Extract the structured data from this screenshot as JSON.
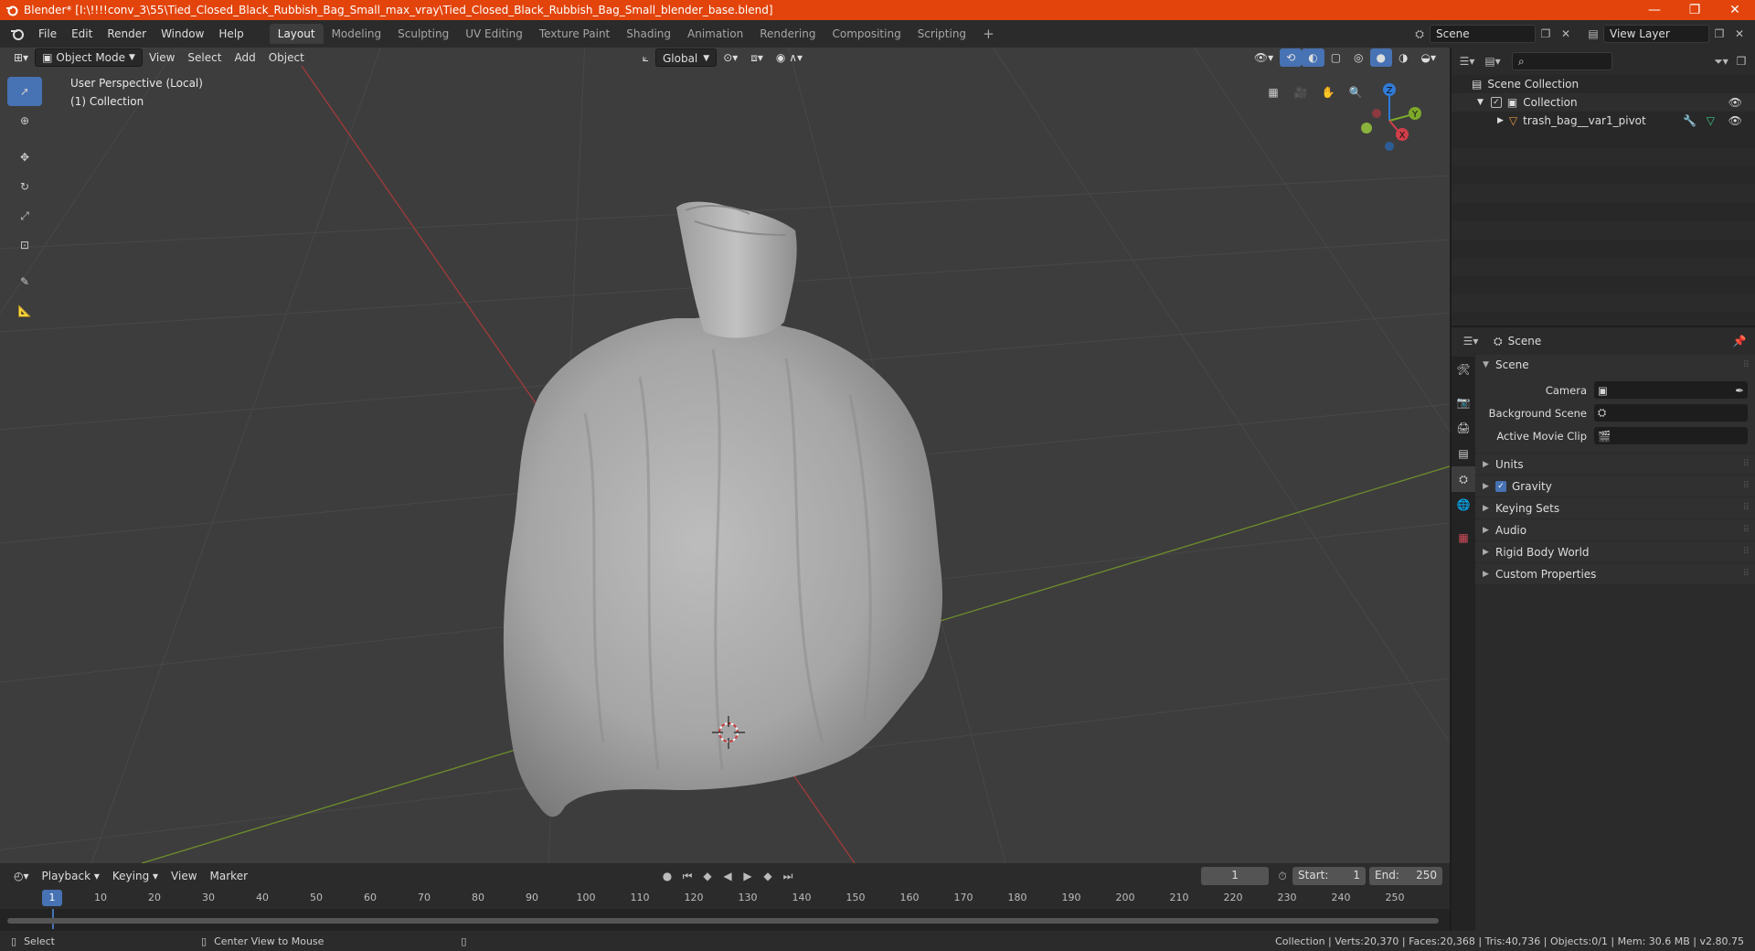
{
  "titlebar": {
    "title": "Blender* [I:\\!!!!conv_3\\55\\Tied_Closed_Black_Rubbish_Bag_Small_max_vray\\Tied_Closed_Black_Rubbish_Bag_Small_blender_base.blend]",
    "minimize": "—",
    "maximize": "❐",
    "close": "✕"
  },
  "menu": [
    "File",
    "Edit",
    "Render",
    "Window",
    "Help"
  ],
  "workspaces": [
    "Layout",
    "Modeling",
    "Sculpting",
    "UV Editing",
    "Texture Paint",
    "Shading",
    "Animation",
    "Rendering",
    "Compositing",
    "Scripting"
  ],
  "active_workspace": "Layout",
  "scene_field": "Scene",
  "view_layer_field": "View Layer",
  "viewport": {
    "mode": "Object Mode",
    "menus": [
      "View",
      "Select",
      "Add",
      "Object"
    ],
    "orientation": "Global",
    "overlay_line1": "User Perspective (Local)",
    "overlay_line2": "(1) Collection",
    "gizmo": {
      "z": "Z",
      "y": "Y",
      "x": "X"
    }
  },
  "timeline": {
    "menus": [
      "Playback",
      "Keying",
      "View",
      "Marker"
    ],
    "current_frame": "1",
    "start_label": "Start:",
    "start": "1",
    "end_label": "End:",
    "end": "250",
    "ticks": [
      "1",
      "10",
      "20",
      "30",
      "40",
      "50",
      "60",
      "70",
      "80",
      "90",
      "100",
      "110",
      "120",
      "130",
      "140",
      "150",
      "160",
      "170",
      "180",
      "190",
      "200",
      "210",
      "220",
      "230",
      "240",
      "250"
    ]
  },
  "outliner": {
    "root": "Scene Collection",
    "collection": "Collection",
    "object": "trash_bag__var1_pivot"
  },
  "properties": {
    "header": "Scene",
    "panel": "Scene",
    "camera_label": "Camera",
    "background_scene_label": "Background Scene",
    "active_movie_clip_label": "Active Movie Clip",
    "subpanels": [
      "Units",
      "Gravity",
      "Keying Sets",
      "Audio",
      "Rigid Body World",
      "Custom Properties"
    ],
    "gravity_checked": true
  },
  "statusbar": {
    "left1": "Select",
    "left2": "Center View to Mouse",
    "right": "Collection | Verts:20,370 | Faces:20,368 | Tris:40,736 | Objects:0/1 | Mem: 30.6 MB | v2.80.75"
  },
  "colors": {
    "titlebar": "#e2440c",
    "accent": "#4772b3",
    "viewport_bg": "#3d3d3d",
    "axis_x": "#b13a3a",
    "axis_y": "#6d8f2c"
  }
}
